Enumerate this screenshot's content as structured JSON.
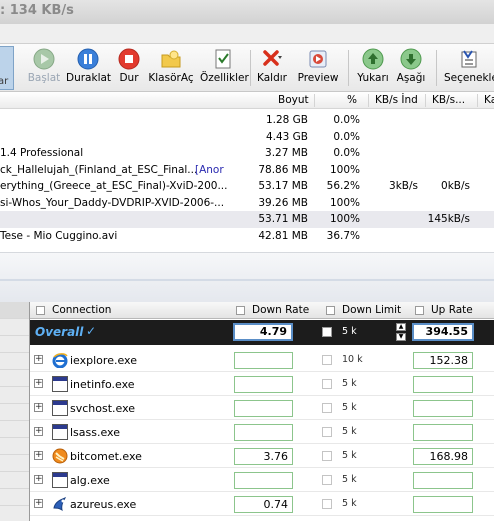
{
  "title_fragment": ": 134 KB/s",
  "toolbar": {
    "left_partial": "ar",
    "buttons": [
      {
        "label": "Başlat",
        "icon": "play-icon",
        "enabled": false
      },
      {
        "label": "Duraklat",
        "icon": "pause-icon",
        "enabled": true
      },
      {
        "label": "Dur",
        "icon": "stop-icon",
        "enabled": true
      },
      {
        "label": "KlasörAç",
        "icon": "folder-icon",
        "enabled": true
      },
      {
        "label": "Özellikler",
        "icon": "properties-icon",
        "enabled": true
      },
      {
        "label": "Kaldır",
        "icon": "remove-icon",
        "enabled": true
      },
      {
        "label": "Preview",
        "icon": "preview-icon",
        "enabled": true
      },
      {
        "label": "Yukarı",
        "icon": "up-arrow-icon",
        "enabled": true
      },
      {
        "label": "Aşağı",
        "icon": "down-arrow-icon",
        "enabled": true
      },
      {
        "label": "Seçenekle",
        "icon": "options-icon",
        "enabled": true
      }
    ]
  },
  "task_list": {
    "headers": {
      "size": "Boyut",
      "percent": "%",
      "down_speed": "KB/s İnd",
      "up_speed": "KB/s...",
      "extra": "Ka"
    },
    "rows": [
      {
        "name": "",
        "size": "1.28 GB",
        "percent": "0.0%",
        "down": "",
        "up": "",
        "tag": ""
      },
      {
        "name": "",
        "size": "4.43 GB",
        "percent": "0.0%",
        "down": "",
        "up": "",
        "tag": ""
      },
      {
        "name": "1.4 Professional",
        "size": "3.27 MB",
        "percent": "0.0%",
        "down": "",
        "up": "",
        "tag": ""
      },
      {
        "name": "ck_Hallelujah_(Finland_at_ESC_Final...",
        "size": "78.86 MB",
        "percent": "100%",
        "down": "",
        "up": "",
        "tag": "[Anor"
      },
      {
        "name": "erything_(Greece_at_ESC_Final)-XviD-200...",
        "size": "53.17 MB",
        "percent": "56.2%",
        "down": "3kB/s",
        "up": "0kB/s",
        "tag": ""
      },
      {
        "name": "si-Whos_Your_Daddy-DVDRIP-XVID-2006-...",
        "size": "39.26 MB",
        "percent": "100%",
        "down": "",
        "up": "",
        "tag": ""
      },
      {
        "name": "",
        "size": "53.71 MB",
        "percent": "100%",
        "down": "",
        "up": "145kB/s",
        "tag": ""
      },
      {
        "name": "Tese - Mio Cuggino.avi",
        "size": "42.81 MB",
        "percent": "36.7%",
        "down": "",
        "up": "",
        "tag": ""
      }
    ]
  },
  "connections": {
    "headers": {
      "connection": "Connection",
      "down_rate": "Down Rate",
      "down_limit": "Down Limit",
      "up_rate": "Up Rate"
    },
    "overall": {
      "label": "Overall",
      "check": "✓",
      "down_rate": "4.79",
      "limit": "5 k",
      "up_rate": "394.55"
    },
    "rows": [
      {
        "name": "iexplore.exe",
        "icon": "ie-icon",
        "down_rate": "",
        "limit": "10 k",
        "up_rate": "152.38"
      },
      {
        "name": "inetinfo.exe",
        "icon": "window-icon",
        "down_rate": "",
        "limit": "5 k",
        "up_rate": ""
      },
      {
        "name": "svchost.exe",
        "icon": "window-icon",
        "down_rate": "",
        "limit": "5 k",
        "up_rate": ""
      },
      {
        "name": "lsass.exe",
        "icon": "window-icon",
        "down_rate": "",
        "limit": "5 k",
        "up_rate": ""
      },
      {
        "name": "bitcomet.exe",
        "icon": "bitcomet-icon",
        "down_rate": "3.76",
        "limit": "5 k",
        "up_rate": "168.98"
      },
      {
        "name": "alg.exe",
        "icon": "window-icon",
        "down_rate": "",
        "limit": "5 k",
        "up_rate": ""
      },
      {
        "name": "azureus.exe",
        "icon": "azureus-icon",
        "down_rate": "0.74",
        "limit": "5 k",
        "up_rate": ""
      }
    ]
  }
}
